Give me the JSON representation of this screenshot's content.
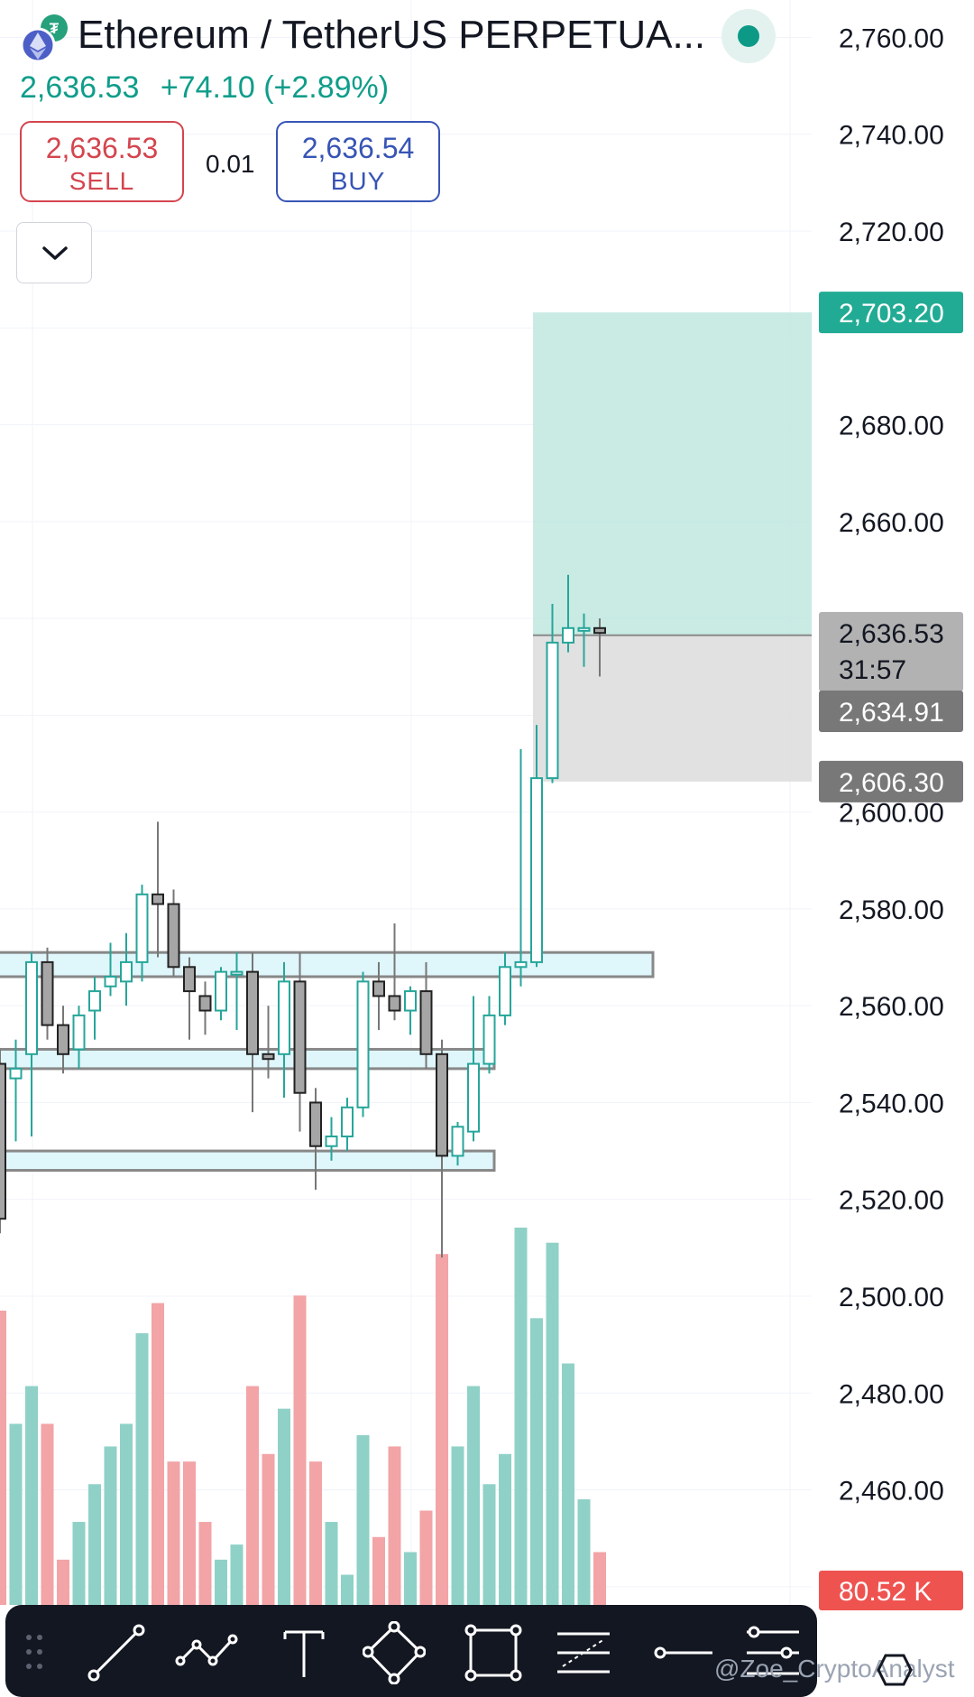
{
  "header": {
    "title": "Ethereum / TetherUS PERPETUA...",
    "last_price": "2,636.53",
    "change": "+74.10 (+2.89%)",
    "sell_price": "2,636.53",
    "sell_label": "SELL",
    "spread": "0.01",
    "buy_price": "2,636.54",
    "buy_label": "BUY",
    "status": "market-open"
  },
  "colors": {
    "up": "#26a69a",
    "up_fill": "#ffffff",
    "down_fill": "#a6a6a6",
    "up_volume": "#8fd1c7",
    "down_volume": "#f2a4a6",
    "accent_green": "#0f9d8a",
    "sell": "#d4454f",
    "buy": "#3754b5",
    "target_zone": "#bfe8df",
    "stop_zone": "#dedede",
    "zone_box": "#dff6fb"
  },
  "chart_data": {
    "type": "candlestick",
    "ylim": [
      2434,
      2764
    ],
    "y_ticks": [
      2760,
      2740,
      2720,
      2700,
      2680,
      2660,
      2640,
      2620,
      2600,
      2580,
      2560,
      2540,
      2520,
      2500,
      2480,
      2460,
      2440
    ],
    "y_tick_labels": [
      "2,760.00",
      "2,740.00",
      "2,720.00",
      "",
      "2,680.00",
      "2,660.00",
      "",
      "",
      "2,600.00",
      "2,580.00",
      "2,560.00",
      "2,540.00",
      "2,520.00",
      "2,500.00",
      "2,480.00",
      "2,460.00",
      "2,440.00"
    ],
    "candles": [
      {
        "o": 2548,
        "h": 2551,
        "l": 2513,
        "c": 2516
      },
      {
        "o": 2545,
        "h": 2553,
        "l": 2532,
        "c": 2547
      },
      {
        "o": 2550,
        "h": 2571,
        "l": 2533,
        "c": 2569
      },
      {
        "o": 2569,
        "h": 2572,
        "l": 2553,
        "c": 2556
      },
      {
        "o": 2556,
        "h": 2560,
        "l": 2546,
        "c": 2550
      },
      {
        "o": 2551,
        "h": 2560,
        "l": 2547,
        "c": 2558
      },
      {
        "o": 2559,
        "h": 2566,
        "l": 2553,
        "c": 2563
      },
      {
        "o": 2564,
        "h": 2573,
        "l": 2562,
        "c": 2566
      },
      {
        "o": 2565,
        "h": 2575,
        "l": 2560,
        "c": 2569
      },
      {
        "o": 2569,
        "h": 2585,
        "l": 2565,
        "c": 2583
      },
      {
        "o": 2583,
        "h": 2598,
        "l": 2570,
        "c": 2581
      },
      {
        "o": 2581,
        "h": 2584,
        "l": 2566,
        "c": 2568
      },
      {
        "o": 2568,
        "h": 2570,
        "l": 2553,
        "c": 2563
      },
      {
        "o": 2562,
        "h": 2565,
        "l": 2554,
        "c": 2559
      },
      {
        "o": 2559,
        "h": 2568,
        "l": 2557,
        "c": 2567
      },
      {
        "o": 2567,
        "h": 2571,
        "l": 2555,
        "c": 2567
      },
      {
        "o": 2567,
        "h": 2571,
        "l": 2538,
        "c": 2550
      },
      {
        "o": 2550,
        "h": 2560,
        "l": 2545,
        "c": 2549
      },
      {
        "o": 2550,
        "h": 2569,
        "l": 2541,
        "c": 2565
      },
      {
        "o": 2565,
        "h": 2571,
        "l": 2534,
        "c": 2542
      },
      {
        "o": 2540,
        "h": 2543,
        "l": 2522,
        "c": 2531
      },
      {
        "o": 2531,
        "h": 2537,
        "l": 2528,
        "c": 2533
      },
      {
        "o": 2533,
        "h": 2541,
        "l": 2530,
        "c": 2539
      },
      {
        "o": 2539,
        "h": 2567,
        "l": 2537,
        "c": 2565
      },
      {
        "o": 2565,
        "h": 2569,
        "l": 2555,
        "c": 2562
      },
      {
        "o": 2562,
        "h": 2577,
        "l": 2557,
        "c": 2559
      },
      {
        "o": 2559,
        "h": 2564,
        "l": 2554,
        "c": 2563
      },
      {
        "o": 2563,
        "h": 2569,
        "l": 2547,
        "c": 2550
      },
      {
        "o": 2550,
        "h": 2553,
        "l": 2508,
        "c": 2529
      },
      {
        "o": 2529,
        "h": 2536,
        "l": 2527,
        "c": 2535
      },
      {
        "o": 2534,
        "h": 2562,
        "l": 2532,
        "c": 2548
      },
      {
        "o": 2548,
        "h": 2562,
        "l": 2546,
        "c": 2558
      },
      {
        "o": 2558,
        "h": 2571,
        "l": 2556,
        "c": 2568
      },
      {
        "o": 2568,
        "h": 2613,
        "l": 2564,
        "c": 2569
      },
      {
        "o": 2569,
        "h": 2618,
        "l": 2568,
        "c": 2607
      },
      {
        "o": 2607,
        "h": 2643,
        "l": 2606,
        "c": 2635
      },
      {
        "o": 2635,
        "h": 2649,
        "l": 2633,
        "c": 2638
      },
      {
        "o": 2638,
        "h": 2641,
        "l": 2630,
        "c": 2638
      },
      {
        "o": 2638,
        "h": 2640,
        "l": 2628,
        "c": 2637
      }
    ],
    "volume_series": [
      0.78,
      0.48,
      0.58,
      0.48,
      0.12,
      0.22,
      0.32,
      0.42,
      0.48,
      0.72,
      0.8,
      0.38,
      0.38,
      0.22,
      0.12,
      0.16,
      0.58,
      0.4,
      0.52,
      0.82,
      0.38,
      0.22,
      0.08,
      0.45,
      0.18,
      0.42,
      0.14,
      0.25,
      0.93,
      0.42,
      0.58,
      0.32,
      0.4,
      1.0,
      0.76,
      0.96,
      0.64,
      0.28,
      0.14
    ],
    "price_levels": [
      {
        "label": "2,703.20",
        "value": 2703.2,
        "color": "#22ab94"
      },
      {
        "label": "2,636.53",
        "sublabel": "31:57",
        "value": 2636.53,
        "color": "#b2b2b2"
      },
      {
        "label": "2,634.91",
        "value": 2634.91,
        "color": "#787878"
      },
      {
        "label": "2,606.30",
        "value": 2606.3,
        "color": "#787878"
      },
      {
        "label": "80.52 K",
        "color": "#ef5350"
      }
    ],
    "position_tool": {
      "entry": 2636.53,
      "target": 2703.2,
      "stop": 2606.3
    },
    "zones": [
      {
        "top": 2571,
        "bottom": 2566
      },
      {
        "top": 2551,
        "bottom": 2547
      },
      {
        "top": 2530,
        "bottom": 2526
      }
    ]
  },
  "toolbar": {
    "tools": [
      "trend-line-icon",
      "path-icon",
      "text-icon",
      "polygon-icon",
      "rectangle-icon",
      "fib-retracement-icon",
      "horizontal-ray-icon",
      "pattern-icon"
    ]
  },
  "watermark": "@Zoe_CryptoAnalyst"
}
